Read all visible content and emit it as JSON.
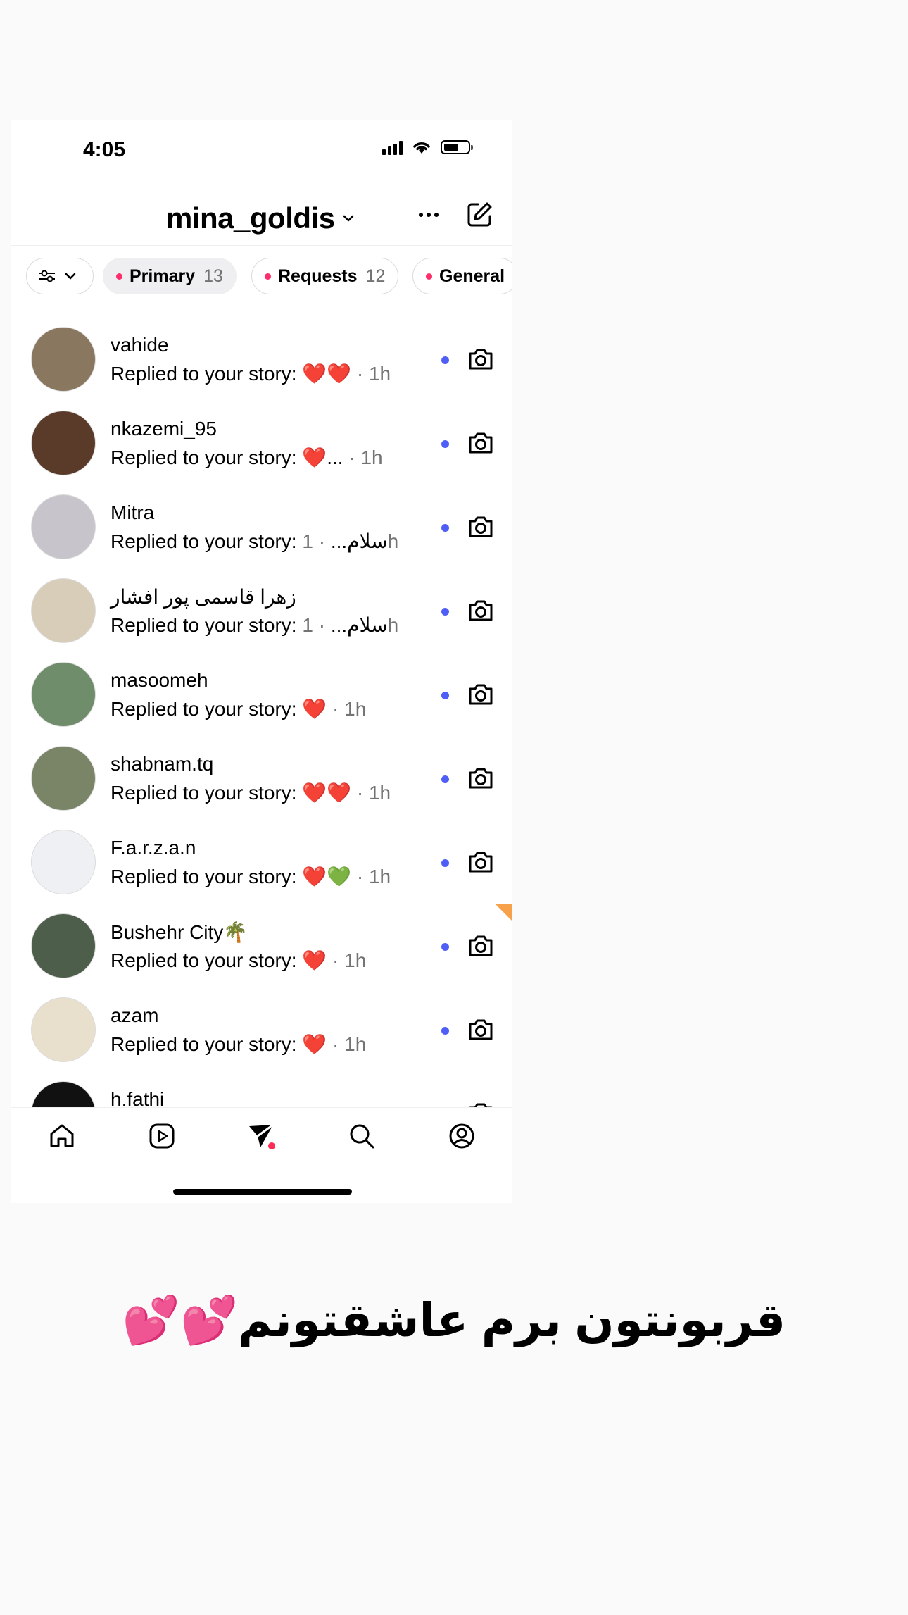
{
  "status_bar": {
    "time": "4:05"
  },
  "header": {
    "account_name": "mina_goldis"
  },
  "filters": {
    "tabs": [
      {
        "label": "Primary",
        "count": "13",
        "active": true
      },
      {
        "label": "Requests",
        "count": "12",
        "active": false
      },
      {
        "label": "General",
        "count": "",
        "active": false
      }
    ]
  },
  "conversations": [
    {
      "name": "vahide",
      "prefix": "Replied to your story:",
      "message": "❤️❤️",
      "time": "· 1h",
      "avatar_color": "#8a7760"
    },
    {
      "name": "nkazemi_95",
      "prefix": "Replied to your story:",
      "message": "❤️...",
      "time": "· 1h",
      "avatar_color": "#5a3b2a"
    },
    {
      "name": "Mitra",
      "prefix": "Replied to your story:",
      "message": "سلام...",
      "time": "· 1h",
      "avatar_color": "#c8c4cc"
    },
    {
      "name": "زهرا قاسمی پور افشار",
      "prefix": "Replied to your story:",
      "message": "سلام...",
      "time": "· 1h",
      "avatar_color": "#d8cdb8"
    },
    {
      "name": "masoomeh",
      "prefix": "Replied to your story:",
      "message": "❤️",
      "time": "· 1h",
      "avatar_color": "#6f8d6a"
    },
    {
      "name": "shabnam.tq",
      "prefix": "Replied to your story:",
      "message": "❤️❤️",
      "time": "· 1h",
      "avatar_color": "#7a8466"
    },
    {
      "name": "F.a.r.z.a.n",
      "prefix": "Replied to your story:",
      "message": "❤️💚",
      "time": "· 1h",
      "avatar_color": "#eef0f3"
    },
    {
      "name": "Bushehr City🌴",
      "prefix": "Replied to your story:",
      "message": "❤️",
      "time": "· 1h",
      "avatar_color": "#4d5f4a"
    },
    {
      "name": "azam",
      "prefix": "Replied to your story:",
      "message": "❤️",
      "time": "· 1h",
      "avatar_color": "#e8e0cc"
    },
    {
      "name": "h.fathi",
      "prefix": "",
      "message": "",
      "time": "",
      "avatar_color": "#111111"
    }
  ],
  "caption": "قربونتون برم عاشقتونم💕💕",
  "colors": {
    "unread_dot": "#4f5ef7",
    "notification_dot": "#ff2d6b",
    "chip_active_bg": "#efeff2"
  }
}
